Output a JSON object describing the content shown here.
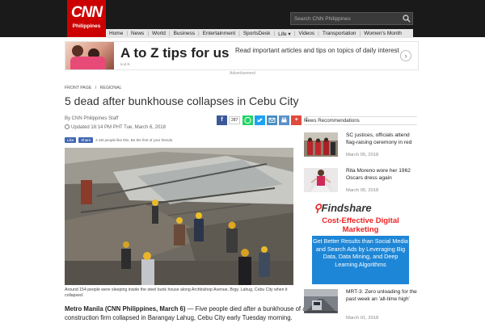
{
  "header": {
    "logo_main": "CNN",
    "logo_sub": "Philippines",
    "search_placeholder": "Search CNN Philippines"
  },
  "nav": {
    "items": [
      "Home",
      "News",
      "World",
      "Business",
      "Entertainment",
      "SportsDesk",
      "Life ▾",
      "Videos",
      "Transportation",
      "Women's Month"
    ]
  },
  "ad": {
    "headline": "A to Z tips for us",
    "source": "kod.lk",
    "text": "Read important articles and tips on topics of daily interest",
    "arrow": "›",
    "label": "Advertisement"
  },
  "breadcrumb": {
    "first": "FRONT PAGE",
    "sep": "/",
    "second": "REGIONAL"
  },
  "article": {
    "title": "5 dead after bunkhouse collapses in Cebu City",
    "byline": "By CNN Philippines Staff",
    "updated": "Updated 16:14 PM PHT Tue, March 6, 2018",
    "share_count": "287",
    "share_count2": "2",
    "fb_like": "Like",
    "fb_share": "Share",
    "fb_text": "2.1M people like this. Be the first of your friends.",
    "caption": "Around 154 people were sleeping inside the steel bunk house along Archbishop Avenue, Brgy. Lahug, Cebu City when it collapsed.",
    "lead_bold": "Metro Manila (CNN Philippines, March 6)",
    "lead_text": " — Five people died after a bunkhouse of a construction firm collapsed in Barangay Lahug, Cebu City early Tuesday morning."
  },
  "sidebar": {
    "header": "News Recommendations",
    "items": [
      {
        "title": "SC justices, officials attend flag-raising ceremony in red",
        "date": "March 05, 2018"
      },
      {
        "title": "Rita Moreno wore her 1962 Oscars dress again",
        "date": "March 05, 2018"
      },
      {
        "title": "MRT-3: Zero unloading for the past week an 'all-time high'",
        "date": "March 01, 2018"
      }
    ]
  },
  "findshare": {
    "brand": "Findshare",
    "headline": "Cost-Effective Digital Marketing",
    "body": "Get Better Results than Social Media and Search Ads by Leveraging Big Data, Data Mining, and Deep Learning Algorithms"
  },
  "colors": {
    "cnn_red": "#cc0000",
    "top_bar": "#1a1a1a",
    "facebook": "#3b5998",
    "whatsapp": "#25d366",
    "twitter": "#1da1f2",
    "findshare_blue": "#1e86d6"
  }
}
